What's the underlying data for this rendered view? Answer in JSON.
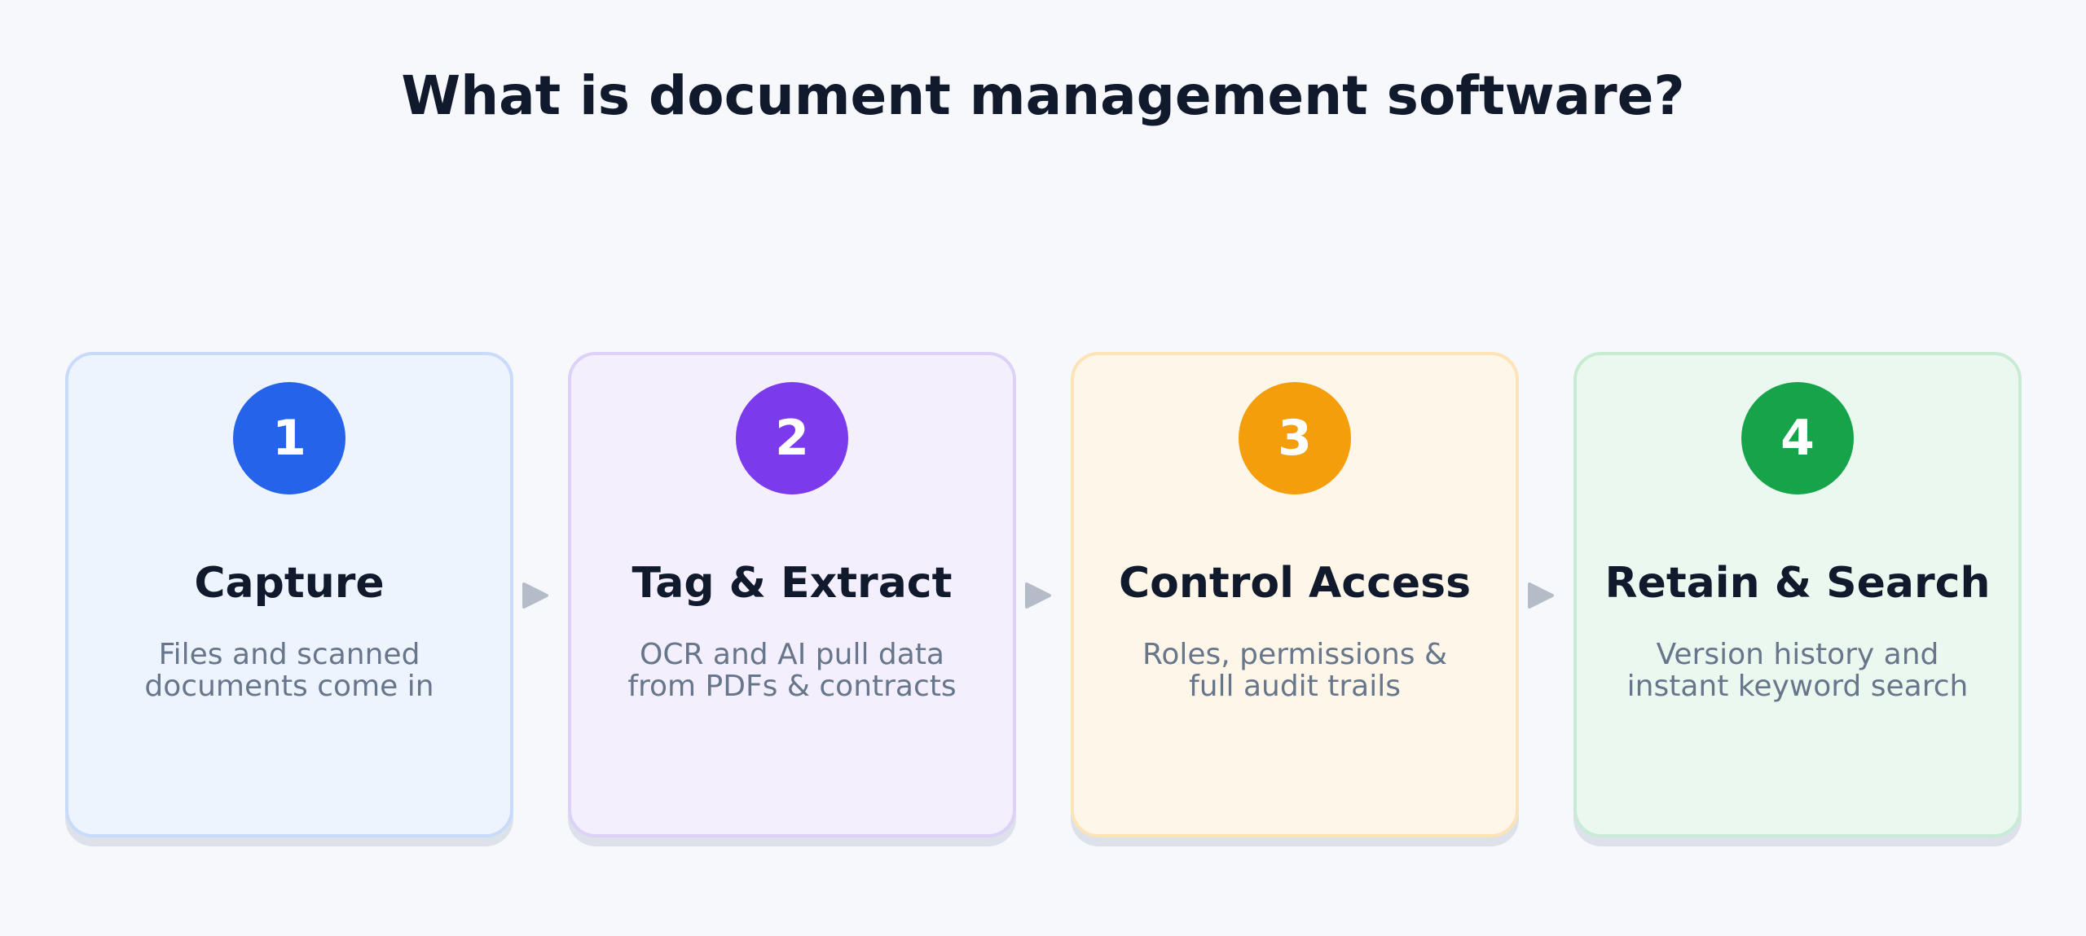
{
  "title": "What is document management software?",
  "steps": [
    {
      "number": "1",
      "title": "Capture",
      "description": [
        "Files and scanned",
        "documents come in"
      ],
      "accent_color": "#2563eb",
      "card_bg": "#eef4fe",
      "card_border": "#c8dbfb"
    },
    {
      "number": "2",
      "title": "Tag & Extract",
      "description": [
        "OCR and AI pull data",
        "from PDFs & contracts"
      ],
      "accent_color": "#7c3aed",
      "card_bg": "#f3effd",
      "card_border": "#ddd1f9"
    },
    {
      "number": "3",
      "title": "Control Access",
      "description": [
        "Roles, permissions &",
        "full audit trails"
      ],
      "accent_color": "#f59e0b",
      "card_bg": "#fef7e9",
      "card_border": "#fde3b6"
    },
    {
      "number": "4",
      "title": "Retain & Search",
      "description": [
        "Version history and",
        "instant keyword search"
      ],
      "accent_color": "#16a34a",
      "card_bg": "#ebf8ef",
      "card_border": "#c7ebd3"
    }
  ],
  "arrow_color": "#b4bcc7"
}
